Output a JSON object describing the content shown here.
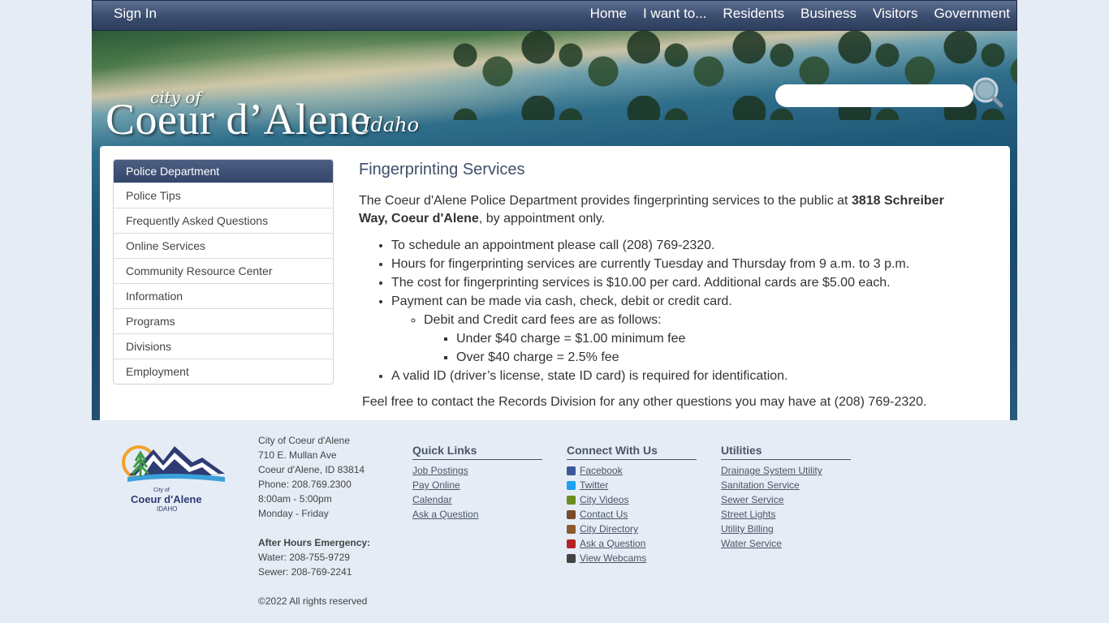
{
  "topnav": {
    "sign_in": "Sign In",
    "links": [
      "Home",
      "I want to...",
      "Residents",
      "Business",
      "Visitors",
      "Government"
    ]
  },
  "logo": {
    "city_of": "city of",
    "name": "Coeur d’Alene",
    "state": "Idaho"
  },
  "search": {
    "placeholder": "",
    "icon": "magnifier-icon"
  },
  "sidebar": {
    "header": "Police Department",
    "items": [
      "Police Tips",
      "Frequently Asked Questions",
      "Online Services",
      "Community Resource Center",
      "Information",
      "Programs",
      "Divisions",
      "Employment"
    ]
  },
  "main": {
    "title": "Fingerprinting Services",
    "intro_pre": "The Coeur d'Alene Police Department provides fingerprinting services to the public at ",
    "intro_bold": "3818 Schreiber Way, Coeur d'Alene",
    "intro_post": ", by appointment only.",
    "bullets": [
      "To schedule an appointment please call (208) 769-2320.",
      "Hours for fingerprinting services are currently Tuesday and Thursday from 9 a.m. to 3 p.m.",
      "The cost for fingerprinting services is $10.00 per card.  Additional cards are $5.00 each.",
      "Payment can be made via cash, check, debit or credit card."
    ],
    "sub_bullet": "Debit and Credit card fees are as follows:",
    "fee_items": [
      "Under $40 charge = $1.00 minimum fee",
      "Over $40 charge = 2.5% fee"
    ],
    "last_bullet": "A valid ID (driver’s license, state ID card) is required for identification.",
    "outro": "Feel free to contact the Records Division for any other questions you may have at (208) 769-2320."
  },
  "footer": {
    "logo_text": {
      "city_of": "City of",
      "name": "Coeur d'Alene",
      "state": "IDAHO"
    },
    "address": {
      "name": "City of Coeur d'Alene",
      "street": "710 E. Mullan Ave",
      "city": "Coeur d'Alene, ID 83814",
      "phone": "Phone: 208.769.2300",
      "hours": "8:00am - 5:00pm",
      "days": "Monday - Friday",
      "emergency_label": "After Hours Emergency:",
      "water": "Water: 208-755-9729",
      "sewer": "Sewer: 208-769-2241",
      "copyright": "©2022 All rights reserved"
    },
    "quick_links": {
      "title": "Quick Links",
      "items": [
        "Job Postings",
        "Pay Online",
        "Calendar",
        "Ask a Question"
      ]
    },
    "connect": {
      "title": "Connect With Us",
      "items": [
        "Facebook",
        "Twitter",
        "City Videos",
        "Contact Us",
        "City Directory",
        "Ask a Question",
        "View Webcams"
      ]
    },
    "utilities": {
      "title": "Utilities",
      "items": [
        "Drainage System Utility",
        "Sanitation Service",
        "Sewer Service",
        "Street Lights",
        "Utility Billing",
        "Water Service"
      ]
    }
  }
}
